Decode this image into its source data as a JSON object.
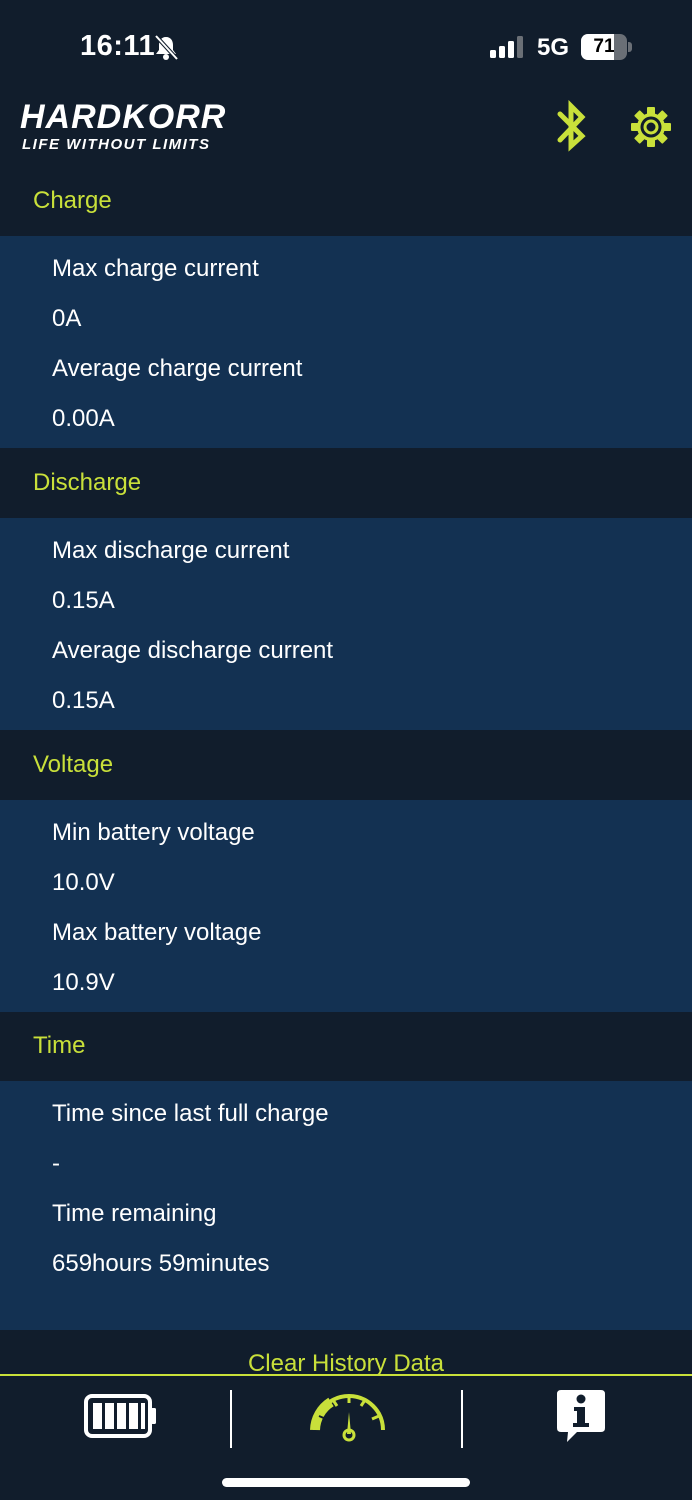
{
  "status_bar": {
    "time": "16:11",
    "network": "5G",
    "battery_percent": "71",
    "battery_level": 0.71
  },
  "header": {
    "logo_name": "HARDKORR",
    "logo_tagline": "LIFE WITHOUT LIMITS",
    "icons": [
      "bluetooth-icon",
      "gear-icon"
    ],
    "accent_color": "#c9e03a"
  },
  "sections": {
    "charge": {
      "title": "Charge",
      "rows": [
        "Max charge current",
        "0A",
        "Average charge current",
        "0.00A"
      ]
    },
    "discharge": {
      "title": "Discharge",
      "rows": [
        "Max discharge current",
        "0.15A",
        "Average discharge current",
        "0.15A"
      ]
    },
    "voltage": {
      "title": "Voltage",
      "rows": [
        "Min battery voltage",
        "10.0V",
        "Max battery voltage",
        "10.9V"
      ]
    },
    "time": {
      "title": "Time",
      "rows": [
        "Time since last full charge",
        "-",
        "Time remaining",
        "659hours 59minutes"
      ]
    }
  },
  "actions": {
    "clear_history": "Clear History Data"
  },
  "tab_bar": {
    "tabs": [
      "battery-icon",
      "gauge-icon",
      "info-icon"
    ]
  },
  "colors": {
    "background": "#111d2c",
    "panel": "#133152",
    "accent": "#c9e03a"
  }
}
